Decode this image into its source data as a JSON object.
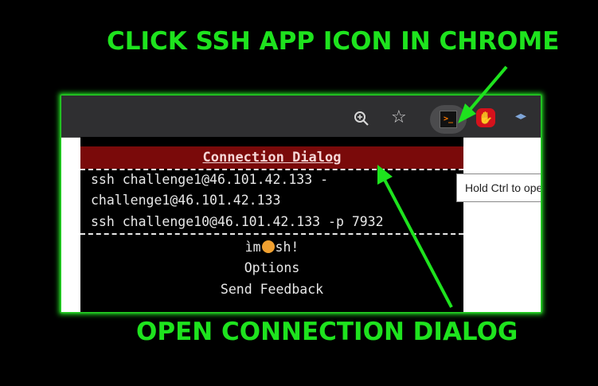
{
  "annotations": {
    "top": "CLICK SSH APP ICON IN CHROME",
    "bottom": "OPEN CONNECTION DIALOG",
    "color": "#1ee31e"
  },
  "toolbar": {
    "zoom_icon": "zoom-in-icon",
    "star_icon": "bookmark-star-icon",
    "ssh_icon_glyph": ">_",
    "adblock_glyph": "✋",
    "dev_glyph": "◂▸"
  },
  "dialog": {
    "header": "Connection Dialog",
    "connections": [
      "ssh challenge1@46.101.42.133 -",
      "challenge1@46.101.42.133",
      "ssh challenge10@46.101.42.133 -p 7932"
    ],
    "brand_left": "ìm",
    "brand_right": "sh!",
    "options": "Options",
    "feedback": "Send Feedback",
    "header_color": "#7a0a0a"
  },
  "tooltip": {
    "text": "Hold Ctrl to open in a"
  }
}
